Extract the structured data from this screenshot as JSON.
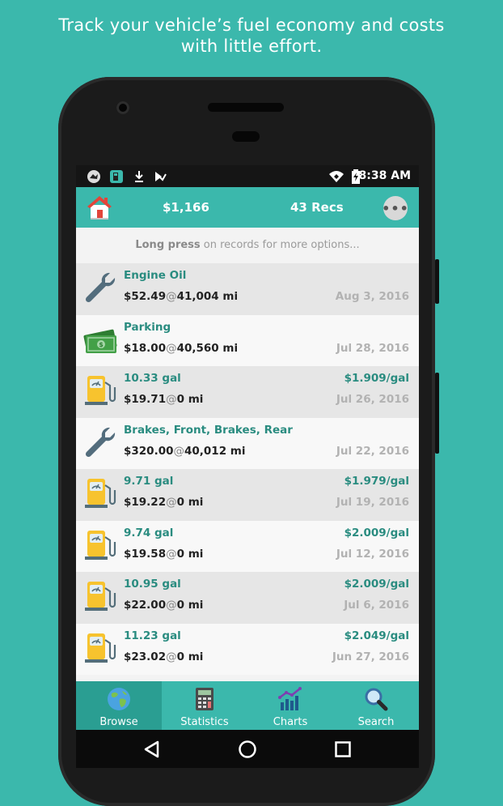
{
  "headline": {
    "line1": "Track your vehicle’s fuel economy and costs",
    "line2": "with little effort."
  },
  "statusbar": {
    "time": "8:38 AM",
    "icons": [
      "bird-app-icon",
      "fuel-app-icon",
      "download-icon",
      "tasks-icon",
      "wifi-icon",
      "battery-charging-icon"
    ]
  },
  "appbar": {
    "total": "$1,166",
    "records": "43 Recs",
    "home_icon": "home-icon",
    "more_icon": "more-icon"
  },
  "hint": {
    "bold": "Long press",
    "rest": "on records for more options..."
  },
  "records": [
    {
      "icon": "wrench-icon",
      "title": "Engine Oil",
      "price": "",
      "cost": "$52.49",
      "odometer": "41,004 mi",
      "date": "Aug 3, 2016"
    },
    {
      "icon": "money-icon",
      "title": "Parking",
      "price": "",
      "cost": "$18.00",
      "odometer": "40,560 mi",
      "date": "Jul 28, 2016"
    },
    {
      "icon": "fuel-pump-icon",
      "title": "10.33 gal",
      "price": "$1.909/gal",
      "cost": "$19.71",
      "odometer": "0 mi",
      "date": "Jul 26, 2016"
    },
    {
      "icon": "wrench-icon",
      "title": "Brakes, Front, Brakes, Rear",
      "price": "",
      "cost": "$320.00",
      "odometer": "40,012 mi",
      "date": "Jul 22, 2016"
    },
    {
      "icon": "fuel-pump-icon",
      "title": "9.71 gal",
      "price": "$1.979/gal",
      "cost": "$19.22",
      "odometer": "0 mi",
      "date": "Jul 19, 2016"
    },
    {
      "icon": "fuel-pump-icon",
      "title": "9.74 gal",
      "price": "$2.009/gal",
      "cost": "$19.58",
      "odometer": "0 mi",
      "date": "Jul 12, 2016"
    },
    {
      "icon": "fuel-pump-icon",
      "title": "10.95 gal",
      "price": "$2.009/gal",
      "cost": "$22.00",
      "odometer": "0 mi",
      "date": "Jul 6, 2016"
    },
    {
      "icon": "fuel-pump-icon",
      "title": "11.23 gal",
      "price": "$2.049/gal",
      "cost": "$23.02",
      "odometer": "0 mi",
      "date": "Jun 27, 2016"
    }
  ],
  "at_symbol": "@",
  "bottomnav": [
    {
      "label": "Browse",
      "icon": "globe-icon",
      "active": true
    },
    {
      "label": "Statistics",
      "icon": "calculator-icon",
      "active": false
    },
    {
      "label": "Charts",
      "icon": "chart-icon",
      "active": false
    },
    {
      "label": "Search",
      "icon": "magnifier-icon",
      "active": false
    }
  ],
  "sysnav": [
    "back-icon",
    "home-circle-icon",
    "recents-icon"
  ],
  "colors": {
    "background": "#3bb8ac",
    "accent_text": "#2a8c80",
    "fuel_yellow": "#f7c32e"
  }
}
